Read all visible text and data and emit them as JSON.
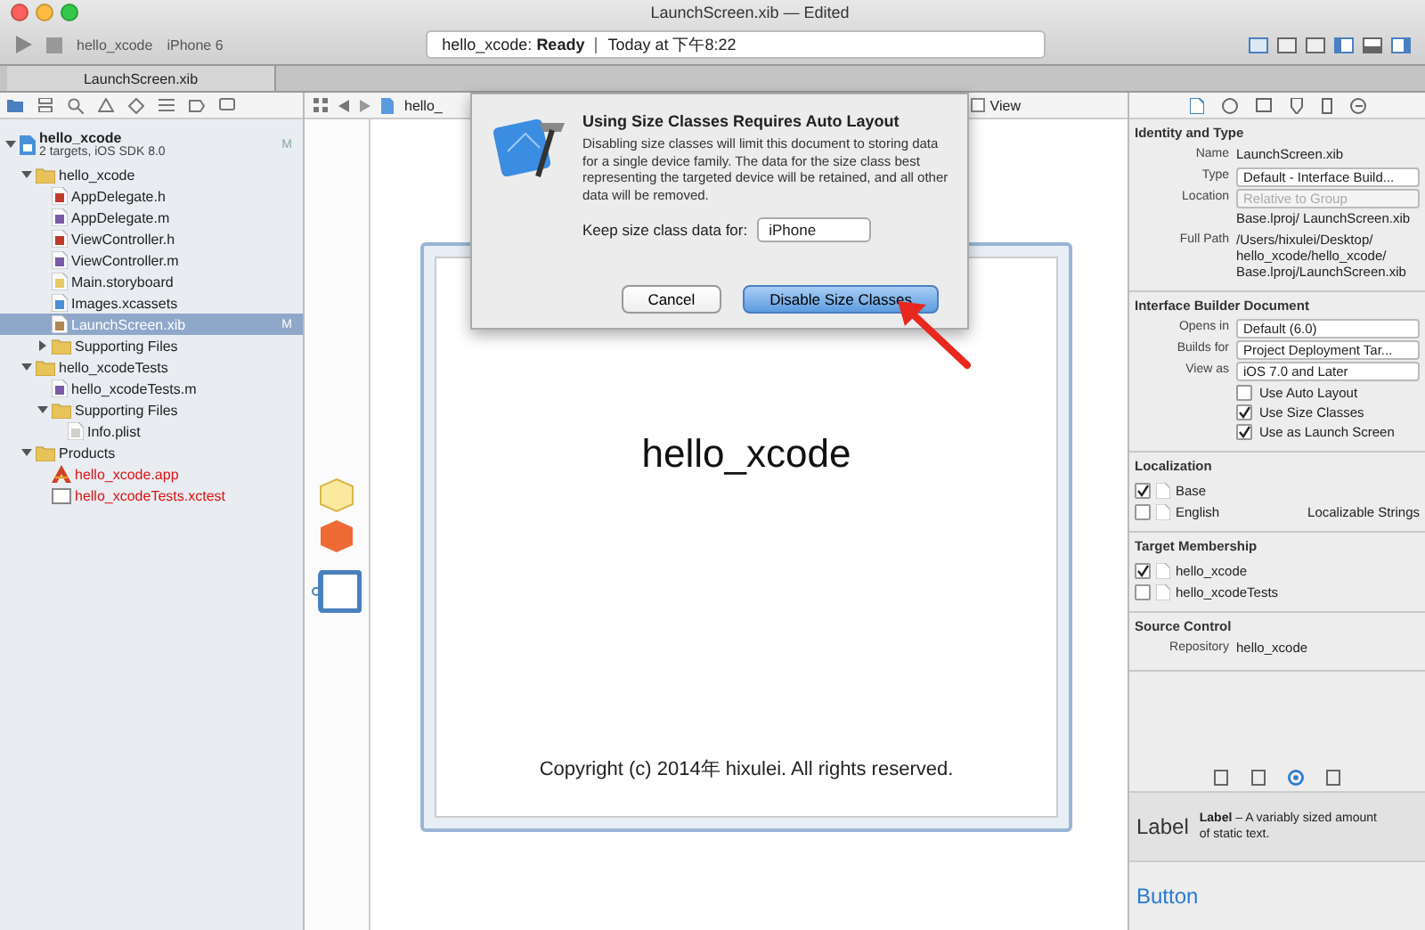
{
  "window": {
    "title": "LaunchScreen.xib — Edited"
  },
  "toolbar": {
    "scheme": "hello_xcode",
    "device": "iPhone 6",
    "status": "hello_xcode: **Ready**",
    "status_time": "Today at 下午8:22"
  },
  "tabs": [
    {
      "label": "LaunchScreen.xib",
      "selected": true
    }
  ],
  "navigator": {
    "items": [
      {
        "name": "hello_xcode",
        "subtitle": "2 targets, iOS SDK 8.0",
        "kind": "project",
        "badge": "M",
        "selected": false,
        "missing": false,
        "expanded": true,
        "children": [
          {
            "name": "hello_xcode",
            "kind": "folder",
            "selected": false,
            "missing": false,
            "expanded": true,
            "children": [
              {
                "name": "AppDelegate.h",
                "kind": "header",
                "selected": false,
                "missing": false
              },
              {
                "name": "AppDelegate.m",
                "kind": "source",
                "selected": false,
                "missing": false
              },
              {
                "name": "ViewController.h",
                "kind": "header",
                "selected": false,
                "missing": false
              },
              {
                "name": "ViewController.m",
                "kind": "source",
                "selected": false,
                "missing": false
              },
              {
                "name": "Main.storyboard",
                "kind": "storyboard",
                "selected": false,
                "missing": false
              },
              {
                "name": "Images.xcassets",
                "kind": "assets",
                "selected": false,
                "missing": false
              },
              {
                "name": "LaunchScreen.xib",
                "kind": "xib",
                "badge": "M",
                "selected": true,
                "missing": false
              },
              {
                "name": "Supporting Files",
                "kind": "folder",
                "selected": false,
                "missing": false,
                "expanded": false
              }
            ]
          },
          {
            "name": "hello_xcodeTests",
            "kind": "folder",
            "selected": false,
            "missing": false,
            "expanded": true,
            "children": [
              {
                "name": "hello_xcodeTests.m",
                "kind": "source",
                "selected": false,
                "missing": false
              },
              {
                "name": "Supporting Files",
                "kind": "folder",
                "selected": false,
                "missing": false,
                "expanded": true,
                "children": [
                  {
                    "name": "Info.plist",
                    "kind": "plist",
                    "selected": false,
                    "missing": false
                  }
                ]
              }
            ]
          },
          {
            "name": "Products",
            "kind": "folder",
            "selected": false,
            "missing": false,
            "expanded": true,
            "children": [
              {
                "name": "hello_xcode.app",
                "kind": "app",
                "selected": false,
                "missing": true
              },
              {
                "name": "hello_xcodeTests.xctest",
                "kind": "bundle",
                "selected": false,
                "missing": true
              }
            ]
          }
        ]
      }
    ]
  },
  "jump_bar": {
    "items": [
      "hello_",
      "View"
    ]
  },
  "dialog": {
    "title": "Using Size Classes Requires Auto Layout",
    "message": "Disabling size classes will limit this document to storing data for a single device family. The data for the size class best representing the targeted device will be retained, and all other data will be removed.",
    "popup_label": "Keep size class data for:",
    "popup_value": "iPhone",
    "buttons": [
      {
        "label": "Cancel",
        "default": false
      },
      {
        "label": "Disable Size Classes",
        "default": true
      }
    ]
  },
  "canvas": {
    "title_label": "hello_xcode",
    "copyright": "Copyright (c) 2014年 hixulei. All rights reserved."
  },
  "inspector": {
    "sections": [
      {
        "title": "Identity and Type",
        "rows": [
          {
            "kind": "text",
            "label": "Name",
            "value": "LaunchScreen.xib"
          },
          {
            "kind": "popup",
            "label": "Type",
            "value": "Default - Interface Build...",
            "disabled": false
          },
          {
            "kind": "popup",
            "label": "Location",
            "value": "Relative to Group",
            "disabled": true
          },
          {
            "kind": "path",
            "label": "",
            "value": "Base.lproj/ LaunchScreen.xib"
          },
          {
            "kind": "text",
            "label": "Full Path",
            "value": "/Users/hixulei/Desktop/ hello_xcode/hello_xcode/ Base.lproj/LaunchScreen.xib"
          }
        ]
      },
      {
        "title": "Interface Builder Document",
        "rows": [
          {
            "kind": "popup",
            "label": "Opens in",
            "value": "Default (6.0)",
            "disabled": false
          },
          {
            "kind": "popup",
            "label": "Builds for",
            "value": "Project Deployment Tar...",
            "disabled": false
          },
          {
            "kind": "popup",
            "label": "View as",
            "value": "iOS 7.0 and Later",
            "disabled": false
          },
          {
            "kind": "checkbox",
            "label": "Use Auto Layout",
            "checked": false
          },
          {
            "kind": "checkbox",
            "label": "Use Size Classes",
            "checked": true
          },
          {
            "kind": "checkbox",
            "label": "Use as Launch Screen",
            "checked": true
          }
        ]
      },
      {
        "title": "Localization",
        "rows": [
          {
            "kind": "check-item",
            "label": "Base",
            "checked": true
          },
          {
            "kind": "check-item",
            "label": "English",
            "checked": false,
            "value": "Localizable Strings"
          }
        ]
      },
      {
        "title": "Target Membership",
        "rows": [
          {
            "kind": "check-item",
            "label": "hello_xcode",
            "checked": true
          },
          {
            "kind": "check-item",
            "label": "hello_xcodeTests",
            "checked": false
          }
        ]
      },
      {
        "title": "Source Control",
        "rows": [
          {
            "kind": "text",
            "label": "Repository",
            "value": "hello_xcode"
          }
        ]
      }
    ]
  },
  "library": {
    "tabs": [
      {
        "selected": false
      },
      {
        "selected": false
      },
      {
        "selected": true
      },
      {
        "selected": false
      }
    ],
    "items": [
      {
        "preview": "Label",
        "description": "**Label** – A variably sized amount of static text."
      },
      {
        "preview": "Button"
      }
    ]
  }
}
